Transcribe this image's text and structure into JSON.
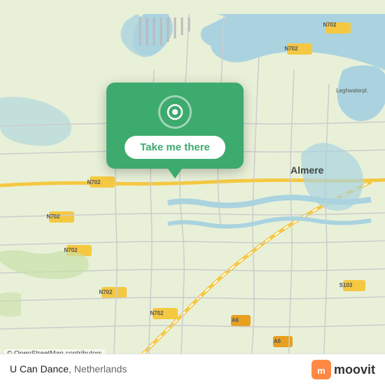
{
  "map": {
    "attribution": "© OpenStreetMap contributors",
    "center_city": "Almere",
    "bg_color": "#e8f0d8"
  },
  "popup": {
    "button_label": "Take me there",
    "icon": "location-pin-icon",
    "bg_color": "#3daa6e"
  },
  "footer": {
    "location_name": "U Can Dance",
    "location_country": "Netherlands",
    "logo_text": "moovit"
  }
}
